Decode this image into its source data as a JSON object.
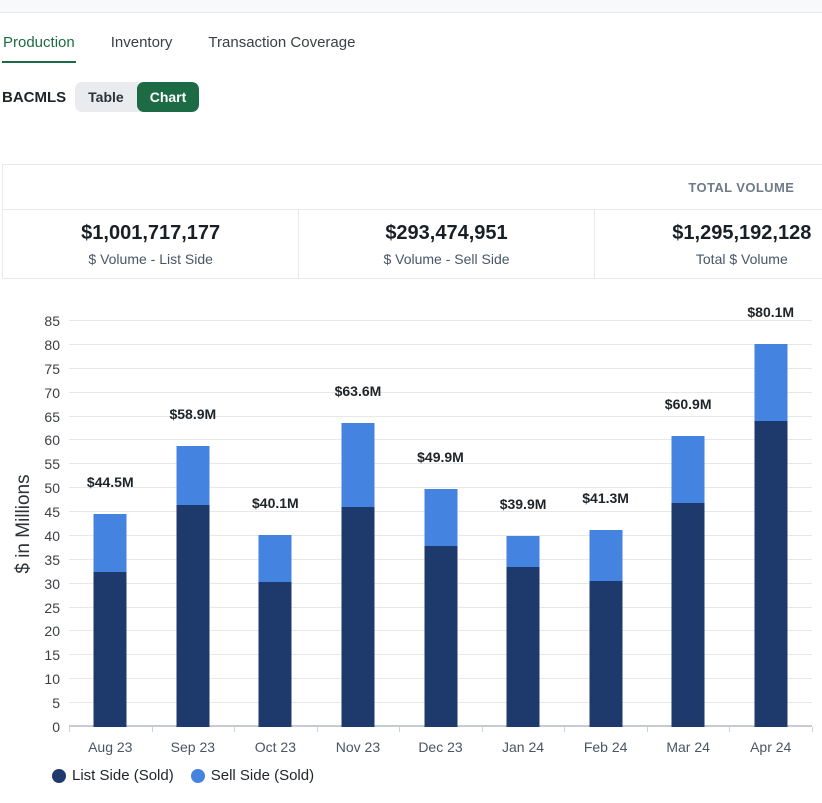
{
  "colors": {
    "green": "#1d6b45",
    "list_side": "#1e3a6d",
    "sell_side": "#4583e0"
  },
  "top_tabs": {
    "items": [
      {
        "label": "Production",
        "active": true
      },
      {
        "label": "Inventory",
        "active": false
      },
      {
        "label": "Transaction Coverage",
        "active": false
      }
    ]
  },
  "toolbar": {
    "source_label": "BACMLS",
    "view_toggle": [
      {
        "label": "Table",
        "active": false
      },
      {
        "label": "Chart",
        "active": true
      }
    ]
  },
  "summary": {
    "header": "TOTAL VOLUME",
    "stats": [
      {
        "value": "$1,001,717,177",
        "caption": "$ Volume - List Side"
      },
      {
        "value": "$293,474,951",
        "caption": "$ Volume - Sell Side"
      },
      {
        "value": "$1,295,192,128",
        "caption": "Total $ Volume"
      }
    ]
  },
  "chart_data": {
    "type": "bar",
    "stacked": true,
    "ylabel": "$ in Millions",
    "xlabel": "",
    "ylim": [
      0,
      85
    ],
    "ytick_step": 5,
    "grid": true,
    "legend_position": "bottom",
    "categories": [
      "Aug 23",
      "Sep 23",
      "Oct 23",
      "Nov 23",
      "Dec 23",
      "Jan 24",
      "Feb 24",
      "Mar 24",
      "Apr 24"
    ],
    "series": [
      {
        "name": "List Side (Sold)",
        "color": "#1e3a6d",
        "values": [
          32.5,
          46.5,
          30.3,
          46.0,
          37.8,
          33.4,
          30.6,
          46.8,
          64.0
        ]
      },
      {
        "name": "Sell Side (Sold)",
        "color": "#4583e0",
        "values": [
          12.0,
          12.4,
          9.8,
          17.6,
          12.1,
          6.5,
          10.7,
          14.1,
          16.1
        ]
      }
    ],
    "totals": [
      44.5,
      58.9,
      40.1,
      63.6,
      49.9,
      39.9,
      41.3,
      60.9,
      80.1
    ],
    "total_labels": [
      "$44.5M",
      "$58.9M",
      "$40.1M",
      "$63.6M",
      "$49.9M",
      "$39.9M",
      "$41.3M",
      "$60.9M",
      "$80.1M"
    ]
  }
}
